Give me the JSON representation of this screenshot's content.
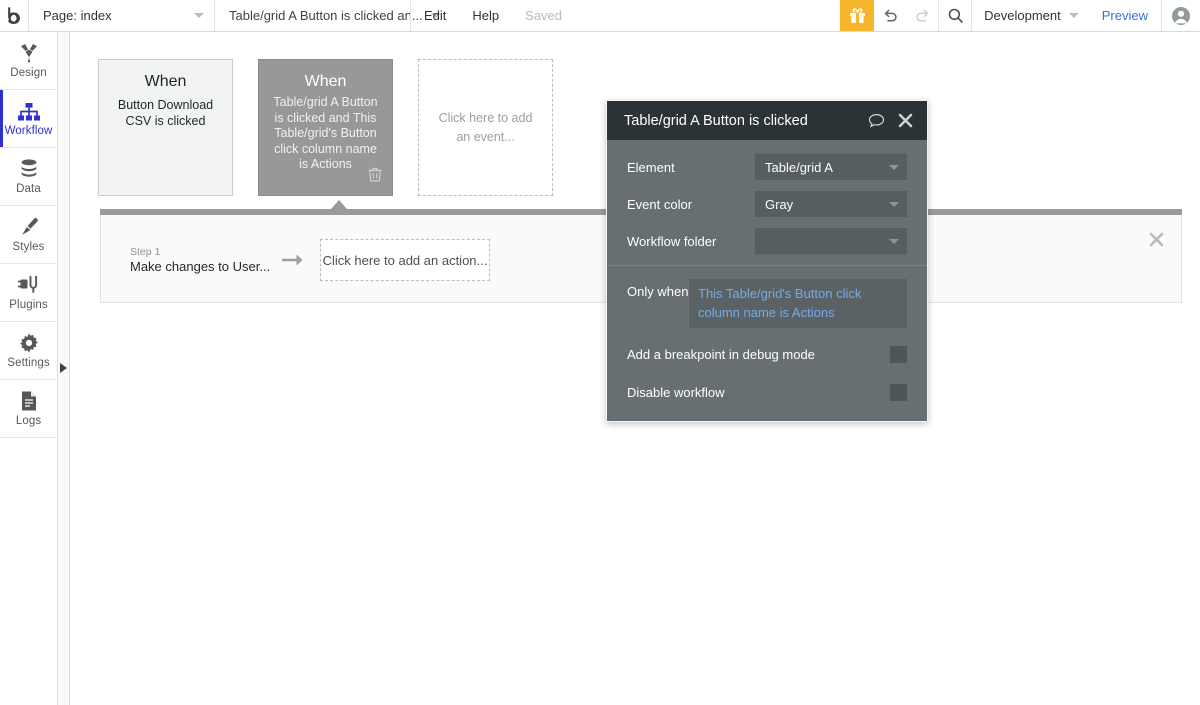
{
  "topbar": {
    "logo_icon": "bubble-logo-icon",
    "page_selector": {
      "label": "Page: index",
      "caret_icon": "chevron-down-icon"
    },
    "workflow_selector": {
      "label": "Table/grid A Button is clicked an...",
      "caret_icon": "chevron-down-icon"
    },
    "edit_label": "Edit",
    "help_label": "Help",
    "saved_label": "Saved",
    "gift_icon": "gift-icon",
    "gift_bg": "#f7b52b",
    "undo_icon": "undo-icon",
    "redo_icon": "redo-icon",
    "search_icon": "search-icon",
    "version_label": "Development",
    "version_caret_icon": "chevron-down-icon",
    "preview_label": "Preview",
    "preview_color": "#3a6ed8",
    "avatar_icon": "user-avatar-icon"
  },
  "sidebar": {
    "items": [
      {
        "label": "Design",
        "icon": "design-icon",
        "active": false
      },
      {
        "label": "Workflow",
        "icon": "workflow-icon",
        "active": true
      },
      {
        "label": "Data",
        "icon": "database-icon",
        "active": false
      },
      {
        "label": "Styles",
        "icon": "paintbrush-icon",
        "active": false
      },
      {
        "label": "Plugins",
        "icon": "plugins-icon",
        "active": false
      },
      {
        "label": "Settings",
        "icon": "gear-icon",
        "active": false
      },
      {
        "label": "Logs",
        "icon": "logs-icon",
        "active": false
      }
    ],
    "active_color": "#2f2fd4",
    "expander_icon": "expand-right-arrow-icon"
  },
  "canvas": {
    "events": [
      {
        "when_label": "When",
        "description": "Button Download CSV is clicked",
        "selected": false
      },
      {
        "when_label": "When",
        "description": "Table/grid A Button is clicked and This Table/grid's Button click column name is Actions",
        "selected": true,
        "delete_icon": "trash-icon",
        "selected_bg": "#989898"
      }
    ],
    "add_event_placeholder": "Click here to add an event...",
    "actions_panel": {
      "step_number_label": "Step 1",
      "step_name": "Make changes to User...",
      "arrow_icon": "arrow-right-icon",
      "add_action_placeholder": "Click here to add an action...",
      "close_icon": "close-icon"
    }
  },
  "dialog": {
    "title": "Table/grid A Button is clicked",
    "comment_icon": "comment-bubble-icon",
    "close_icon": "close-icon",
    "header_bg": "#2b3336",
    "body_bg": "#676f72",
    "fields": [
      {
        "label": "Element",
        "value": "Table/grid A",
        "caret_icon": "chevron-down-icon"
      },
      {
        "label": "Event color",
        "value": "Gray",
        "caret_icon": "chevron-down-icon"
      },
      {
        "label": "Workflow folder",
        "value": "",
        "caret_icon": "chevron-down-icon"
      }
    ],
    "only_when": {
      "label": "Only when",
      "expression": "This Table/grid's Button click column name is Actions",
      "expression_color": "#76a9e8"
    },
    "checkboxes": [
      {
        "label": "Add a breakpoint in debug mode",
        "checked": false
      },
      {
        "label": "Disable workflow",
        "checked": false
      }
    ]
  }
}
